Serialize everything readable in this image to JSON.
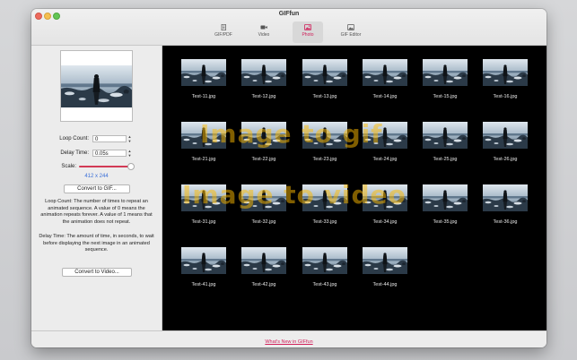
{
  "window": {
    "title": "GIFfun"
  },
  "toolbar": {
    "tabs": [
      {
        "label": "GIF/PDF",
        "icon": "document-icon"
      },
      {
        "label": "Video",
        "icon": "video-camera-icon"
      },
      {
        "label": "Photo",
        "icon": "photo-icon",
        "active": true
      },
      {
        "label": "GIF Editor",
        "icon": "image-editor-icon"
      }
    ]
  },
  "settings": {
    "loop_count_label": "Loop Count:",
    "loop_count_value": "0",
    "delay_time_label": "Delay Time:",
    "delay_time_value": "0.05s",
    "scale_label": "Scale:",
    "scale_fraction": 0.95,
    "size_readout": "412 x 244",
    "convert_gif_label": "Convert to GIF...",
    "help_loop": "Loop Count: The number of times to repeat an animated sequence. A value of 0 means the animation repeats forever. A value of 1 means that the animation does not repeat.",
    "help_delay": "Delay Time: The amount of time, in seconds, to wait before displaying the next image in an animated sequence.",
    "convert_video_label": "Convert to Video..."
  },
  "thumbnails": [
    [
      "Test-11.jpg",
      "Test-12.jpg",
      "Test-13.jpg",
      "Test-14.jpg",
      "Test-15.jpg",
      "Test-16.jpg"
    ],
    [
      "Test-21.jpg",
      "Test-22.jpg",
      "Test-23.jpg",
      "Test-24.jpg",
      "Test-25.jpg",
      "Test-26.jpg"
    ],
    [
      "Test-31.jpg",
      "Test-32.jpg",
      "Test-33.jpg",
      "Test-34.jpg",
      "Test-35.jpg",
      "Test-36.jpg"
    ],
    [
      "Test-41.jpg",
      "Test-42.jpg",
      "Test-43.jpg",
      "Test-44.jpg"
    ]
  ],
  "overlays": {
    "image_to_gif": "Image to gif",
    "image_to_video": "Image to video"
  },
  "footer": {
    "link": "What's New in GIFfun"
  },
  "colors": {
    "accent": "#d0205a",
    "link_blue": "#3a6fd8",
    "overlay": "#ffbb00"
  }
}
